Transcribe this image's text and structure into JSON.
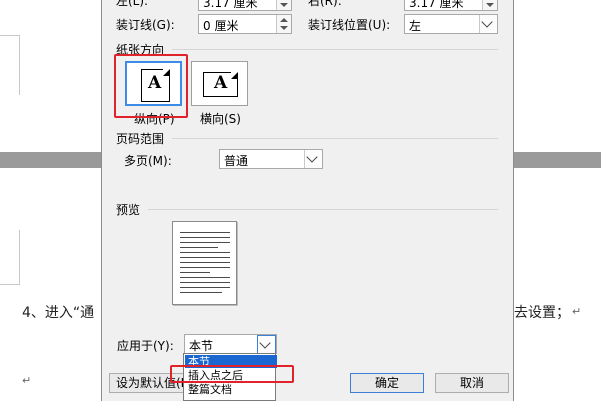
{
  "document": {
    "body_text_left": "4、进入“通",
    "body_text_right": "去设置；",
    "paragraph_mark": "↵"
  },
  "dialog": {
    "margins": {
      "left_label": "左(L):",
      "left_value": "3.17 厘米",
      "right_label": "右(R):",
      "right_value": "3.17 厘米",
      "gutter_label": "装订线(G):",
      "gutter_value": "0 厘米",
      "gutter_pos_label": "装订线位置(U):",
      "gutter_pos_value": "左"
    },
    "orientation": {
      "heading": "纸张方向",
      "portrait_label": "纵向(P)",
      "landscape_label": "横向(S)",
      "icon_letter": "A"
    },
    "pages": {
      "heading": "页码范围",
      "multiple_label": "多页(M):",
      "multiple_value": "普通"
    },
    "preview": {
      "heading": "预览"
    },
    "apply_to": {
      "label": "应用于(Y):",
      "value": "本节",
      "options": [
        "本节",
        "插入点之后",
        "整篇文档"
      ],
      "highlighted_option": "本节"
    },
    "buttons": {
      "set_default": "设为默认值(D)",
      "ok": "确定",
      "cancel": "取消"
    }
  },
  "colors": {
    "highlight_red": "#e0232b",
    "selection_blue": "#1a67d2",
    "dialog_bg": "#f0f0f0"
  }
}
